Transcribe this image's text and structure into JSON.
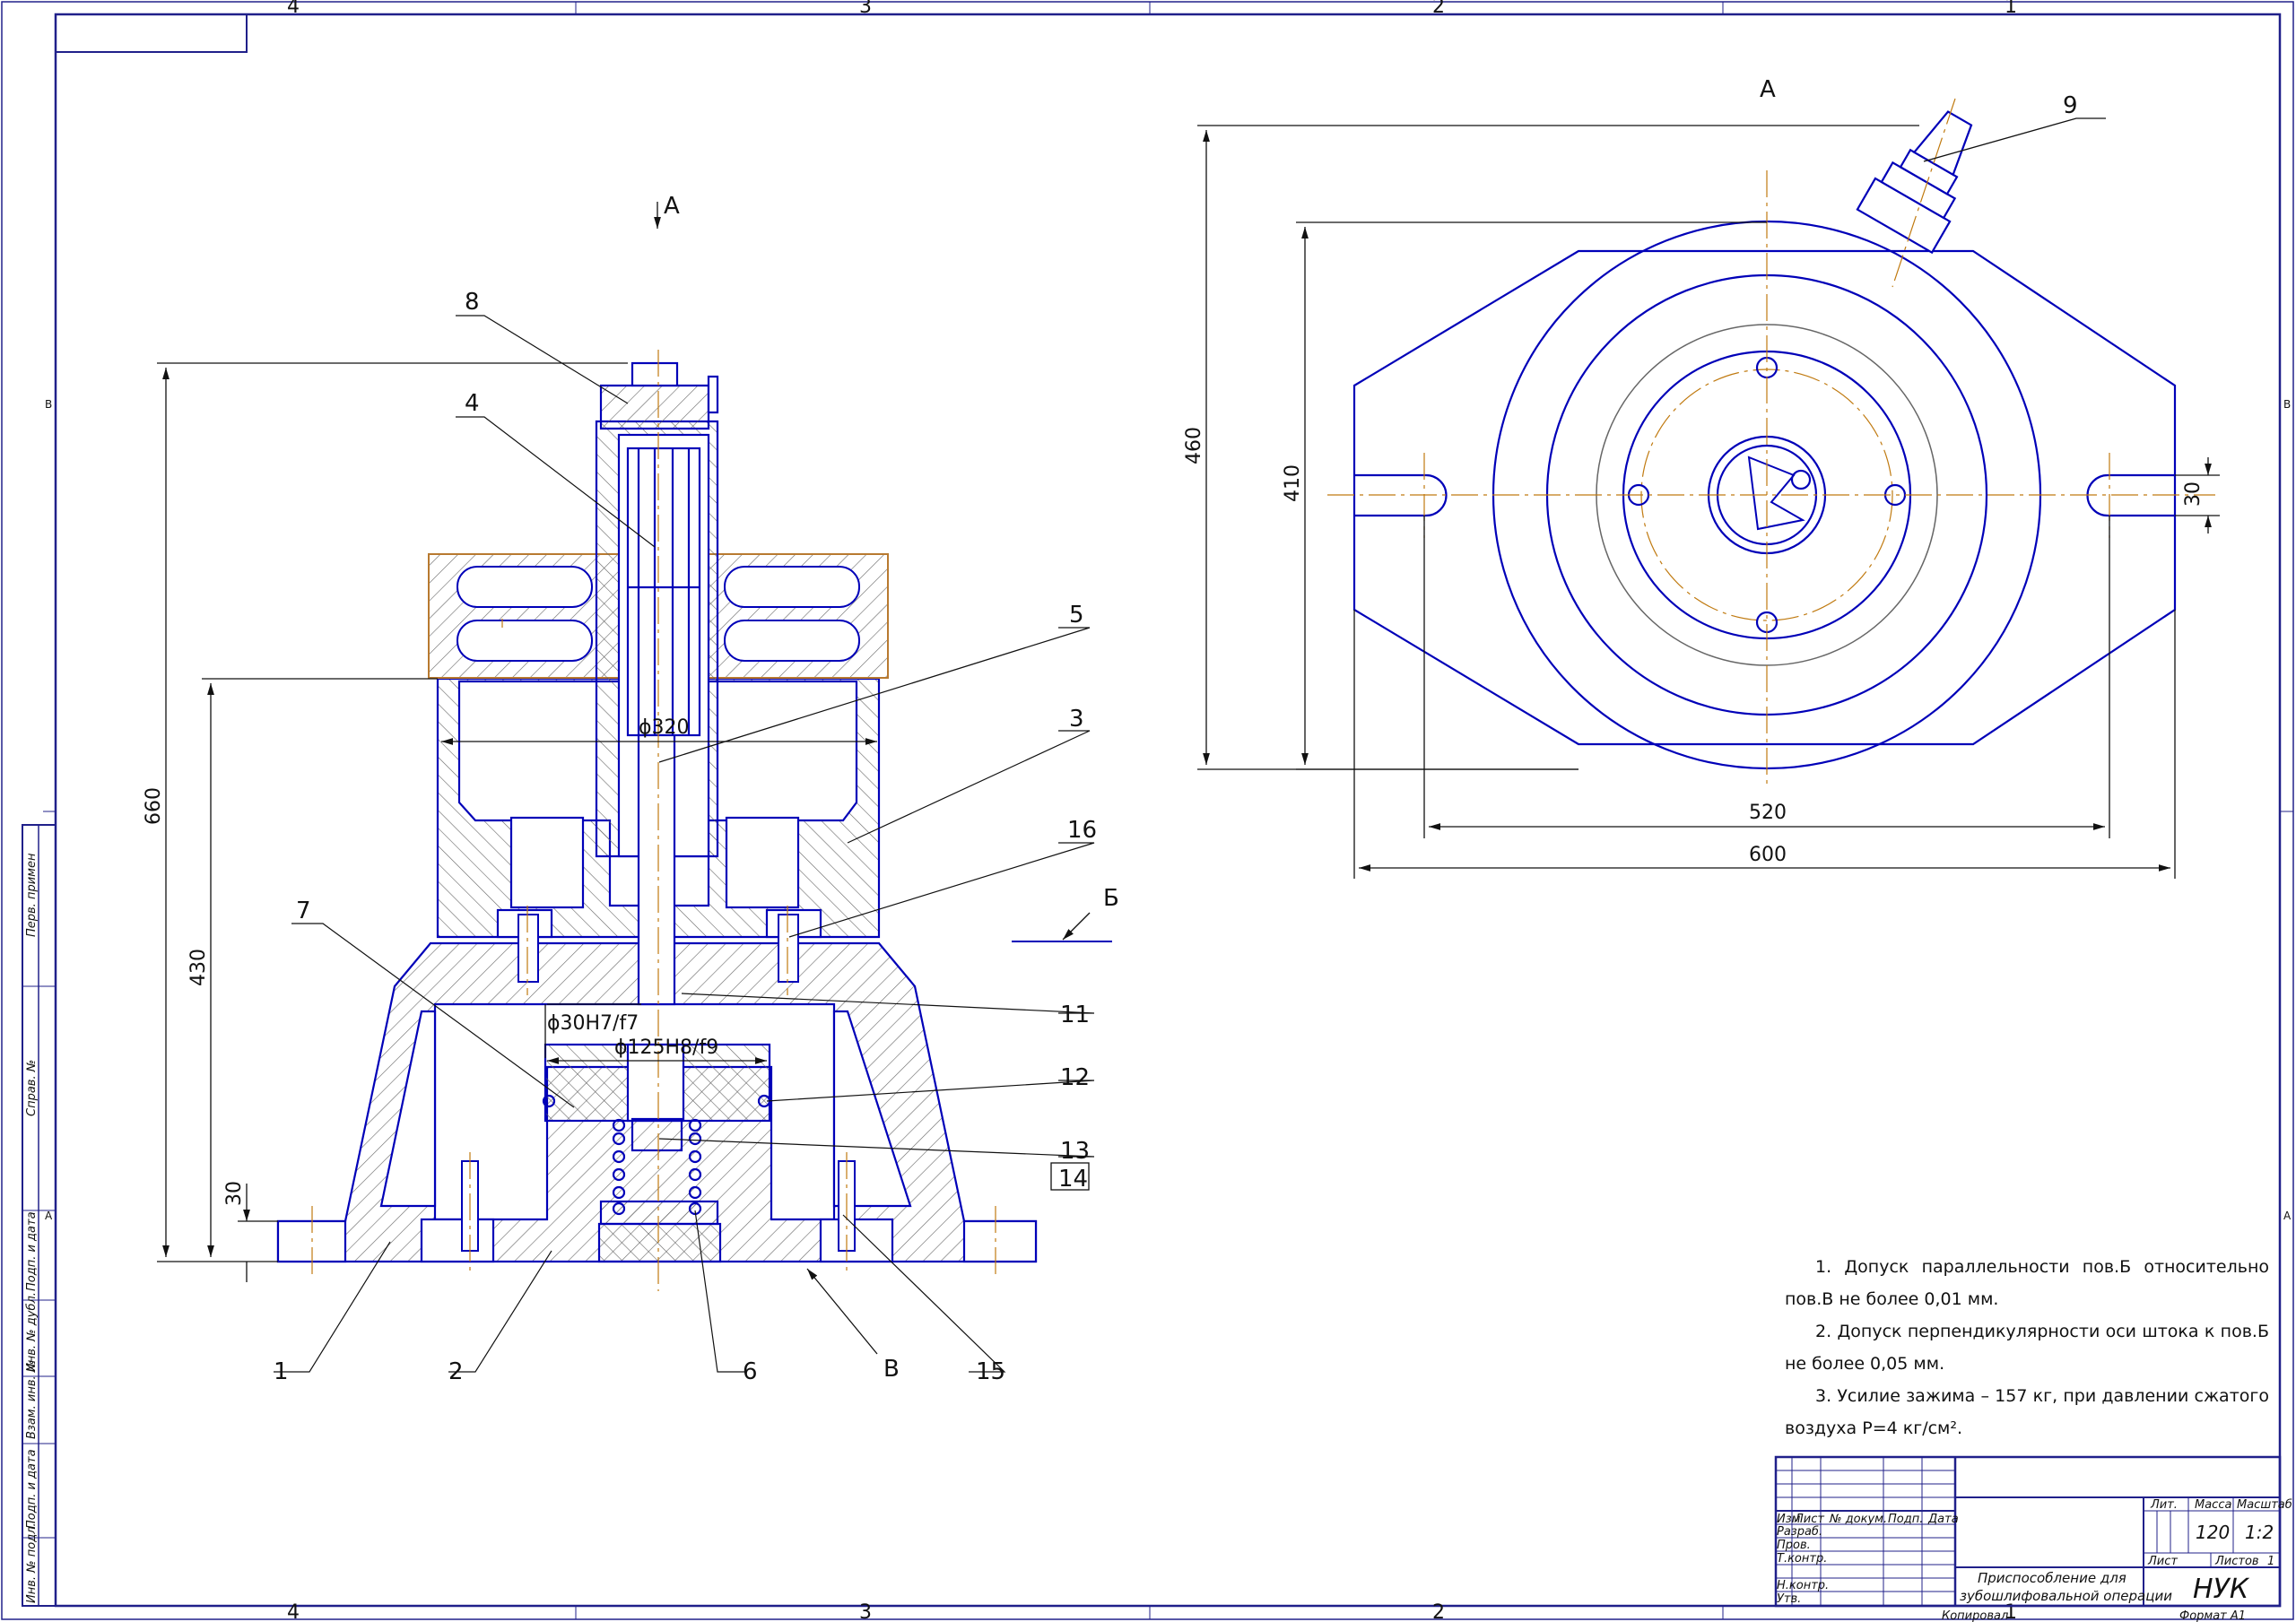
{
  "frame": {
    "zones_top": [
      "4",
      "3",
      "2",
      "1"
    ],
    "zones_bottom": [
      "4",
      "3",
      "2",
      "1"
    ],
    "zones_side": [
      "B",
      "A"
    ],
    "side_stamp": [
      "Перв. примен",
      "Справ. №",
      "Подп. и дата",
      "Инв. № дубл.",
      "Взам. инв. №",
      "Подп. и дата",
      "Инв. № подл."
    ]
  },
  "section_view": {
    "view_mark": "A",
    "diameters": [
      "ϕ320",
      "ϕ30H7/f7",
      "ϕ125H8/f9"
    ],
    "heights": [
      "660",
      "430",
      "30"
    ],
    "surface_marks": [
      "Б",
      "В"
    ],
    "callouts": [
      "8",
      "4",
      "5",
      "3",
      "16",
      "7",
      "11",
      "12",
      "13",
      "14",
      "1",
      "2",
      "6",
      "15"
    ]
  },
  "top_view": {
    "title": "A",
    "callout": "9",
    "dims": {
      "height_outer": "460",
      "height_inner": "410",
      "slot": "30",
      "width_inner": "520",
      "width_outer": "600"
    }
  },
  "notes": [
    "1. Допуск параллельности пов.Б относительно пов.В не более 0,01 мм.",
    "2. Допуск перпендикулярности оси штока к пов.Б не более 0,05 мм.",
    "3. Усилие зажима – 157 кг, при давлении сжатого воздуха  Р=4 кг/см²."
  ],
  "title_block": {
    "col_headers": [
      "Изм",
      "Лист",
      "№ докум.",
      "Подп.",
      "Дата"
    ],
    "rows": [
      "Разраб.",
      "Пров.",
      "Т.контр.",
      "Н.контр.",
      "Утв."
    ],
    "product_name": [
      "Приспособление для",
      "зубошлифовальной операции"
    ],
    "org": "НУК",
    "lit_label": "Лит.",
    "mass_label": "Масса",
    "scale_label": "Масштаб",
    "mass": "120",
    "scale": "1:2",
    "sheet_label": "Лист",
    "sheets_label": "Листов",
    "sheets": "1",
    "copied": "Копировал",
    "format": "Формат    А1"
  },
  "colors": {
    "outline": "#0000b8",
    "axis": "#c07a10",
    "hatch": "#555555",
    "frame": "#20208a"
  }
}
